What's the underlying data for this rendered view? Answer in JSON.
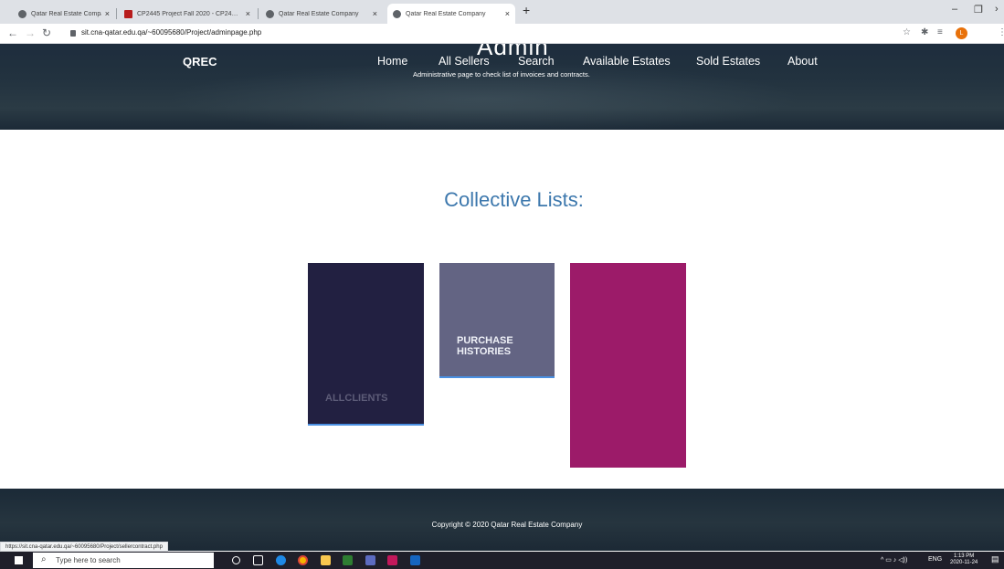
{
  "browser": {
    "tabs": [
      {
        "label": "Qatar Real Estate Company"
      },
      {
        "label": "CP2445 Project Fall 2020 - CP24…"
      },
      {
        "label": "Qatar Real Estate Company"
      },
      {
        "label": "Qatar Real Estate Company"
      }
    ],
    "new_tab": "+",
    "url": "sit.cna-qatar.edu.qa/~60095680/Project/adminpage.php",
    "profile_initial": "L"
  },
  "header": {
    "brand": "QREC",
    "title": "Admin",
    "subtitle": "Administrative page to check list of invoices and contracts.",
    "nav": [
      "Home",
      "All Sellers",
      "Search",
      "Available Estates",
      "Sold Estates",
      "About"
    ]
  },
  "main": {
    "heading": "Collective Lists:",
    "cards": [
      {
        "label": "ALLCLIENTS",
        "color": "#222041"
      },
      {
        "label": "PURCHASE HISTORIES",
        "color": "#636483"
      },
      {
        "label": "",
        "color": "#9c1b69"
      }
    ]
  },
  "footer": {
    "copyright": "Copyright © 2020 Qatar Real Estate Company"
  },
  "status_url": "https://sit.cna-qatar.edu.qa/~60095680/Project/sellercontract.php",
  "taskbar": {
    "search_placeholder": "Type here to search",
    "language": "ENG",
    "time": "1:13 PM",
    "date": "2020-11-24"
  }
}
